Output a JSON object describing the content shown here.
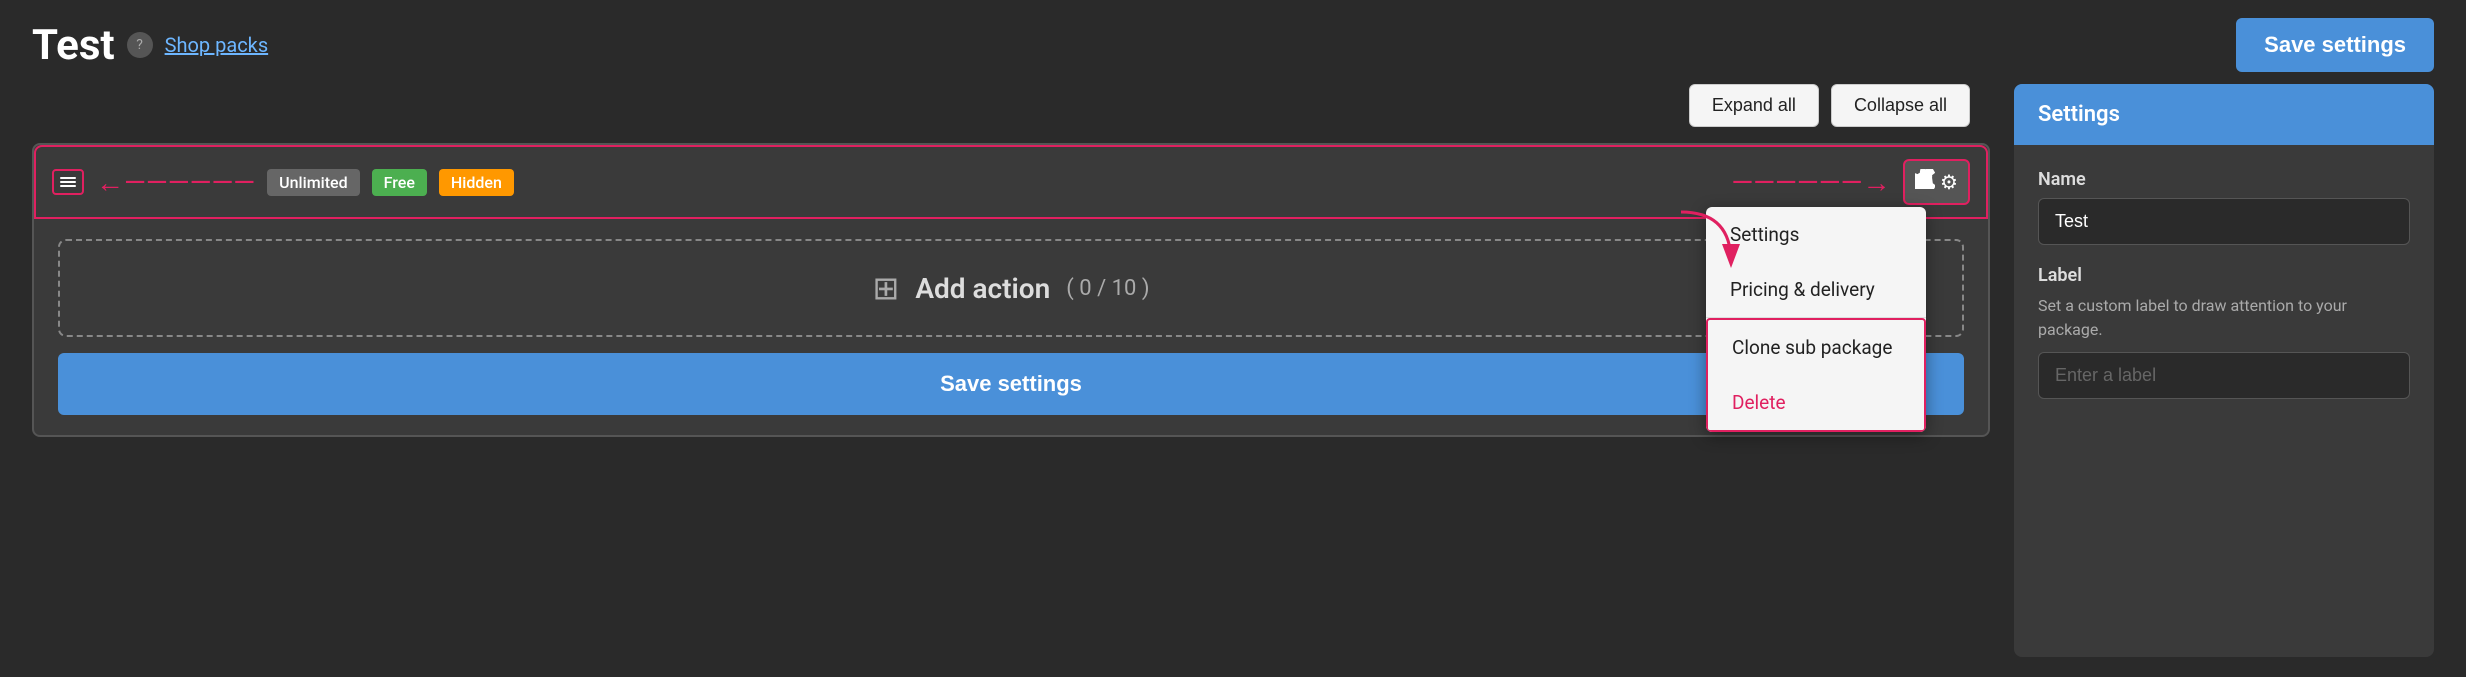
{
  "header": {
    "title": "Test",
    "help_icon": "?",
    "shop_packs_label": "Shop packs",
    "save_settings_label": "Save settings"
  },
  "toolbar": {
    "expand_all_label": "Expand all",
    "collapse_all_label": "Collapse all"
  },
  "package": {
    "badges": [
      "Unlimited",
      "Free",
      "Hidden"
    ],
    "add_action_text": "Add action",
    "add_action_count": "( 0 / 10 )",
    "save_settings_label": "Save settings"
  },
  "context_menu": {
    "settings_label": "Settings",
    "pricing_delivery_label": "Pricing & delivery",
    "clone_label": "Clone sub package",
    "delete_label": "Delete"
  },
  "sidebar": {
    "header_label": "Settings",
    "name_label": "Name",
    "name_value": "Test",
    "label_label": "Label",
    "label_description": "Set a custom label to draw attention to your package.",
    "label_placeholder": "Enter a label"
  }
}
